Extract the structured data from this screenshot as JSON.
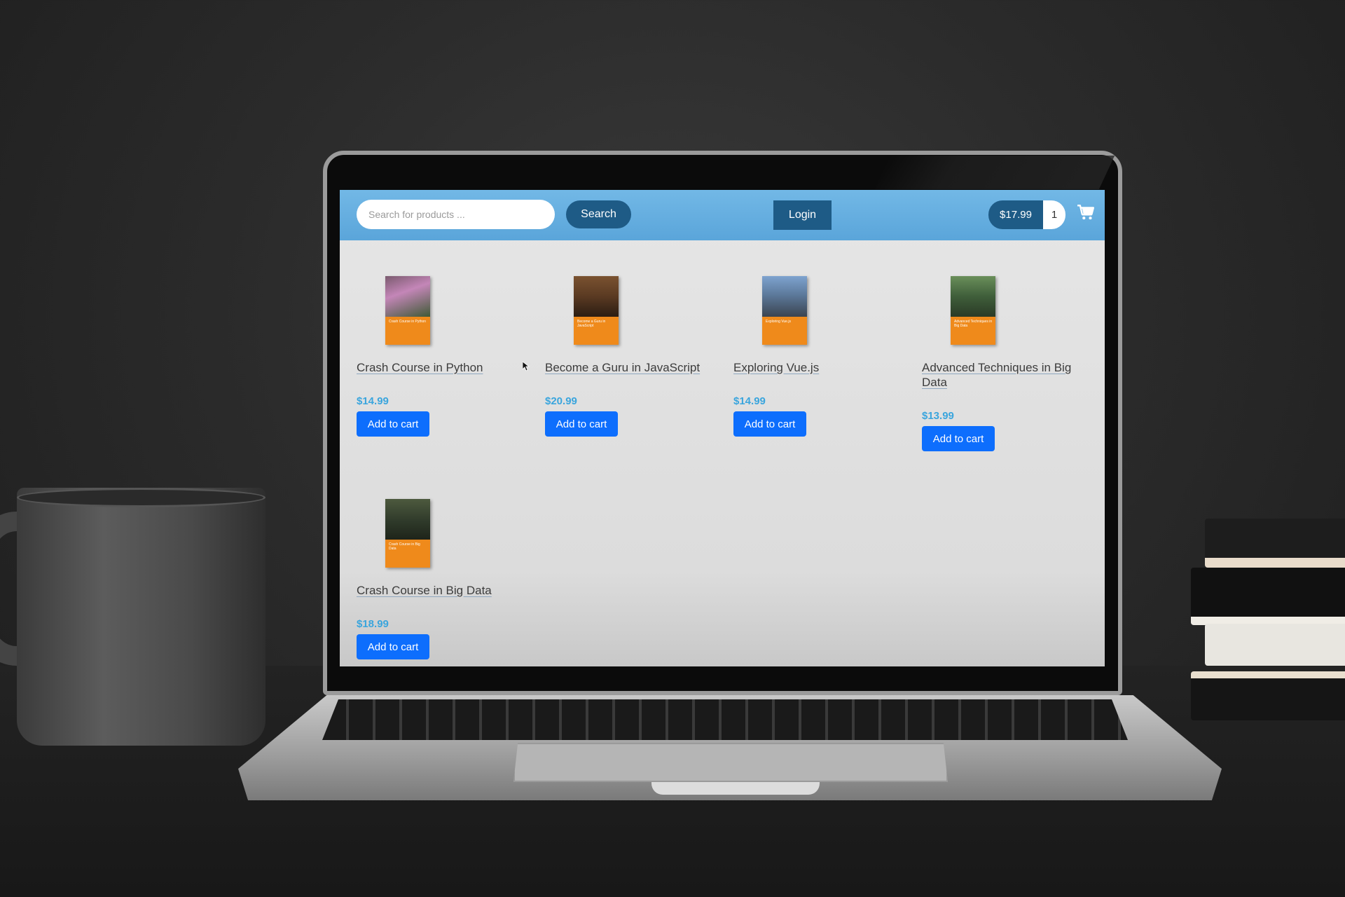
{
  "header": {
    "search_placeholder": "Search for products ...",
    "search_label": "Search",
    "login_label": "Login",
    "cart_total": "$17.99",
    "cart_count": "1",
    "cart_icon": "shopping-cart-icon"
  },
  "products": [
    {
      "title": "Crash Course in Python",
      "price": "$14.99",
      "button": "Add to cart",
      "cover_text": "Crash Course in Python"
    },
    {
      "title": "Become a Guru in JavaScript",
      "price": "$20.99",
      "button": "Add to cart",
      "cover_text": "Become a Guru in JavaScript"
    },
    {
      "title": "Exploring Vue.js",
      "price": "$14.99",
      "button": "Add to cart",
      "cover_text": "Exploring Vue.js"
    },
    {
      "title": "Advanced Techniques in Big Data",
      "price": "$13.99",
      "button": "Add to cart",
      "cover_text": "Advanced Techniques in Big Data"
    },
    {
      "title": "Crash Course in Big Data",
      "price": "$18.99",
      "button": "Add to cart",
      "cover_text": "Crash Course in Big Data"
    }
  ],
  "colors": {
    "navbar": "#5aa5da",
    "dark_button": "#1e5b86",
    "primary_button": "#0d6efd",
    "price": "#3aa5dd",
    "cover_band": "#ef8a1b"
  }
}
